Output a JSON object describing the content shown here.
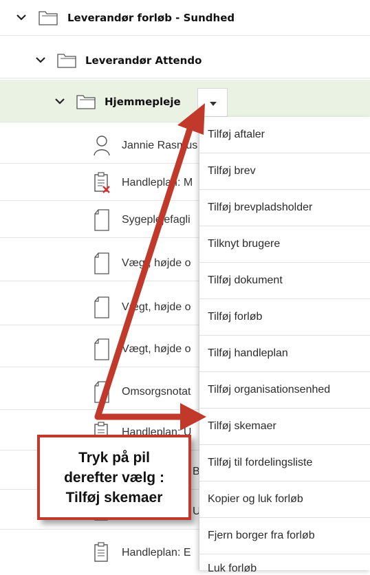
{
  "tree": {
    "level0": {
      "label": "Leverandør forløb - Sundhed"
    },
    "level1": {
      "label": "Leverandør Attendo"
    },
    "level2": {
      "label": "Hjemmepleje"
    }
  },
  "items": [
    {
      "label": "Jannie Rasmus",
      "icon": "person-icon"
    },
    {
      "label": "Handleplan: M",
      "icon": "clipboard-error-icon"
    },
    {
      "label": "Sygeplejefagli",
      "icon": "document-icon"
    },
    {
      "label": "Vægt, højde o",
      "icon": "document-icon"
    },
    {
      "label": "Vægt, højde o",
      "icon": "document-icon"
    },
    {
      "label": "Vægt, højde o",
      "icon": "document-icon"
    },
    {
      "label": "Omsorgsnotat",
      "icon": "document-icon"
    },
    {
      "label": "Handleplan: U",
      "icon": "clipboard-icon"
    },
    {
      "label": "B",
      "icon": "clipboard-icon"
    },
    {
      "label": "U",
      "icon": "clipboard-icon"
    },
    {
      "label": "Handleplan: E",
      "icon": "clipboard-icon"
    }
  ],
  "menu": {
    "items": [
      "Tilføj aftaler",
      "Tilføj brev",
      "Tilføj brevpladsholder",
      "Tilknyt brugere",
      "Tilføj dokument",
      "Tilføj forløb",
      "Tilføj handleplan",
      "Tilføj organisationsenhed",
      "Tilføj skemaer",
      "Tilføj til fordelingsliste",
      "Kopier og luk forløb",
      "Fjern borger fra forløb",
      "Luk forløb"
    ]
  },
  "callout": {
    "line1": "Tryk på pil",
    "line2": "derefter vælg :",
    "line3": "Tilføj skemaer"
  },
  "colors": {
    "selected_row": "#eaf2e4",
    "annotation": "#c0392b"
  }
}
